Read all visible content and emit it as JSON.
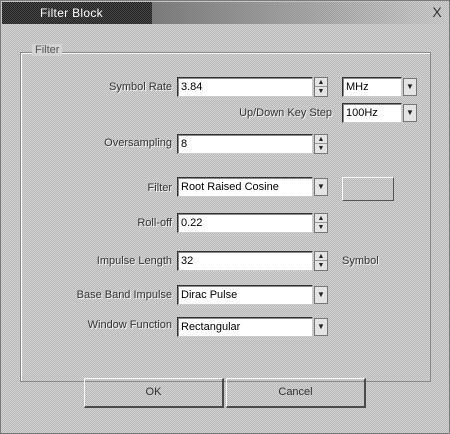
{
  "window": {
    "title": "Filter Block",
    "close_label": "X"
  },
  "group": {
    "title": "Filter"
  },
  "fields": {
    "symbol_rate": {
      "label": "Symbol Rate",
      "value": "3.84",
      "unit": "MHz"
    },
    "key_step": {
      "label": "Up/Down Key Step",
      "value": "100Hz"
    },
    "oversampling": {
      "label": "Oversampling",
      "value": "8"
    },
    "filter": {
      "label": "Filter",
      "value": "Root Raised Cosine"
    },
    "rolloff": {
      "label": "Roll-off",
      "value": "0.22"
    },
    "impulse_length": {
      "label": "Impulse Length",
      "value": "32",
      "unit": "Symbol"
    },
    "base_band_impulse": {
      "label": "Base Band Impulse",
      "value": "Dirac Pulse"
    },
    "window_function": {
      "label": "Window Function",
      "value": "Rectangular"
    }
  },
  "buttons": {
    "ok": "OK",
    "cancel": "Cancel"
  },
  "icons": {
    "spin_up": "▲",
    "spin_down": "▼",
    "dropdown": "▼"
  }
}
